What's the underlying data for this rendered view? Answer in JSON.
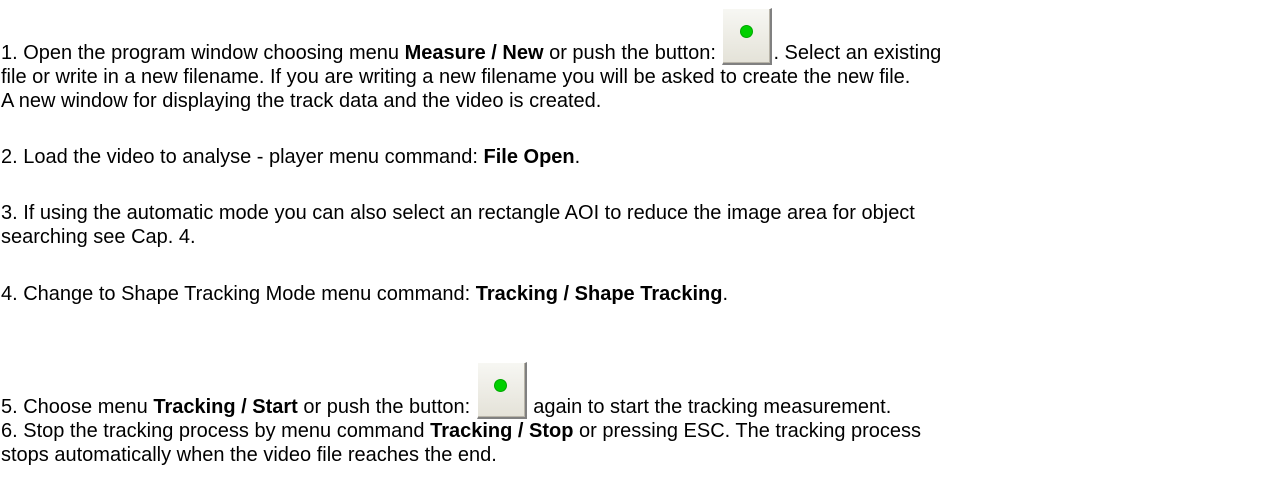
{
  "icons": {
    "button_icon": "green-dot-button-icon",
    "dot_color": "#00d000"
  },
  "steps": [
    {
      "lines": [
        {
          "a": "1. Open the program window choosing menu ",
          "b": "Measure / New",
          "c": " or push the button: ",
          "d": ". Select an existing"
        },
        "file or write in a new filename. If you are writing a new filename you will be asked to create the new file.",
        "A new window for displaying the track data and the video is created."
      ]
    },
    {
      "a": "2. Load the video to analyse - player menu command: ",
      "b": "File Open",
      "c": "."
    },
    {
      "lines": [
        "3. If using the automatic mode you can also select an rectangle AOI to reduce the image area for object",
        "searching see Cap. 4."
      ]
    },
    {
      "a": "4. Change to Shape Tracking Mode menu command: ",
      "b": "Tracking / Shape Tracking",
      "c": "."
    },
    {
      "a": "5. Choose menu ",
      "b": "Tracking / Start",
      "c": " or push the button: ",
      "d": " again to start the tracking measurement."
    },
    {
      "lines": [
        {
          "a": "6. Stop the tracking process by menu command ",
          "b": "Tracking / Stop",
          "c": " or pressing ESC. The tracking process"
        },
        "stops automatically when the video file reaches the end."
      ]
    }
  ]
}
